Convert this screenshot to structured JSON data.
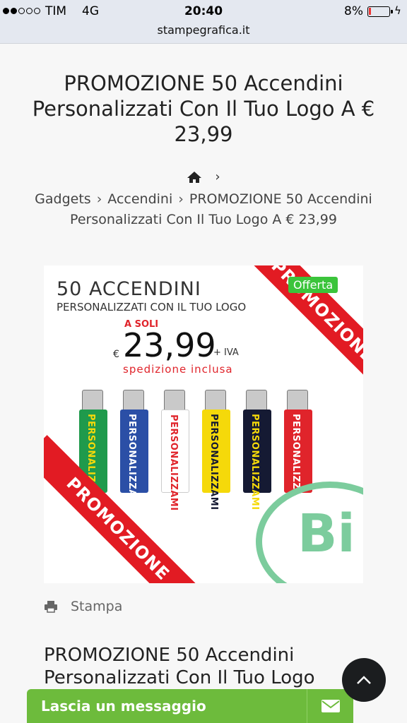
{
  "status_bar": {
    "carrier": "TIM",
    "network": "4G",
    "time": "20:40",
    "battery": "8%",
    "url": "stampegrafica.it"
  },
  "page": {
    "title": "PROMOZIONE 50 Accendini Personalizzati Con Il Tuo Logo A € 23,99"
  },
  "breadcrumb": {
    "separator": "›",
    "items": [
      "Gadgets",
      "Accendini",
      "PROMOZIONE 50 Accendini Personalizzati Con Il Tuo Logo A € 23,99"
    ]
  },
  "product_image": {
    "badge": "Offerta",
    "title_line1": "50 ACCENDINI",
    "title_line2": "PERSONALIZZATI CON IL TUO LOGO",
    "a_soli": "A SOLI",
    "currency": "€",
    "price": "23,99",
    "iva": "+ IVA",
    "shipping": "spedizione inclusa",
    "ribbon": "PROMOZIONE",
    "lighter_text": "PERSONALIZZAMI",
    "watermark": "Bi",
    "lighter_colors": [
      "#1f9a4c",
      "#2b4fa6",
      "#ffffff",
      "#f5d90a",
      "#151a33",
      "#e0242b"
    ],
    "lighter_text_colors": [
      "#f5d90a",
      "#ffffff",
      "#e0242b",
      "#151a33",
      "#f5d90a",
      "#ffffff"
    ]
  },
  "actions": {
    "print_label": "Stampa"
  },
  "content": {
    "subtitle": "PROMOZIONE 50 Accendini Personalizzati Con Il Tuo Logo"
  },
  "chat": {
    "label": "Lascia un messaggio"
  },
  "icons": {
    "home": "home-icon",
    "print": "printer-icon",
    "scroll_top": "chevron-up-icon",
    "mail": "envelope-icon"
  }
}
